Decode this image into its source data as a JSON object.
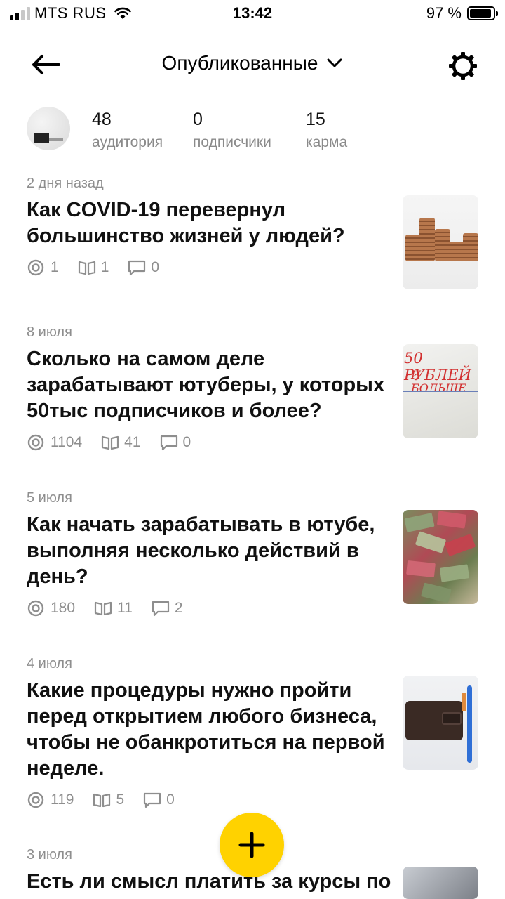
{
  "status_bar": {
    "carrier": "MTS RUS",
    "time": "13:42",
    "battery": "97 %"
  },
  "header": {
    "title": "Опубликованные"
  },
  "profile": {
    "stats": [
      {
        "value": "48",
        "label": "аудитория"
      },
      {
        "value": "0",
        "label": "подписчики"
      },
      {
        "value": "15",
        "label": "карма"
      }
    ]
  },
  "articles": [
    {
      "date": "2 дня назад",
      "title": "Как COVID-19 перевернул большинство жизней у людей?",
      "views": "1",
      "reads": "1",
      "comments": "0"
    },
    {
      "date": "8 июля",
      "title": "Сколько на самом деле зарабатывают ютуберы, у которых 50тыс подписчиков и более?",
      "views": "1104",
      "reads": "41",
      "comments": "0",
      "thumb_text_1": "50 РУБЛЕЙ",
      "thumb_text_2": "И БОЛЬШЕ"
    },
    {
      "date": "5 июля",
      "title": "Как начать зарабатывать в ютубе, выполняя несколько действий в день?",
      "views": "180",
      "reads": "11",
      "comments": "2"
    },
    {
      "date": "4 июля",
      "title": "Какие процедуры нужно пройти перед открытием любого бизнеса, чтобы не обанкротиться на первой неделе.",
      "views": "119",
      "reads": "5",
      "comments": "0"
    },
    {
      "date": "3 июля",
      "title": "Есть ли смысл платить за курсы по"
    }
  ],
  "icons": {
    "back": "arrow-left-icon",
    "dropdown": "chevron-down-icon",
    "settings": "gear-icon",
    "views": "eye-icon",
    "reads": "book-icon",
    "comments": "comment-icon",
    "add": "plus-icon"
  },
  "colors": {
    "accent": "#ffd200",
    "meta_text": "#8e8e8e"
  }
}
